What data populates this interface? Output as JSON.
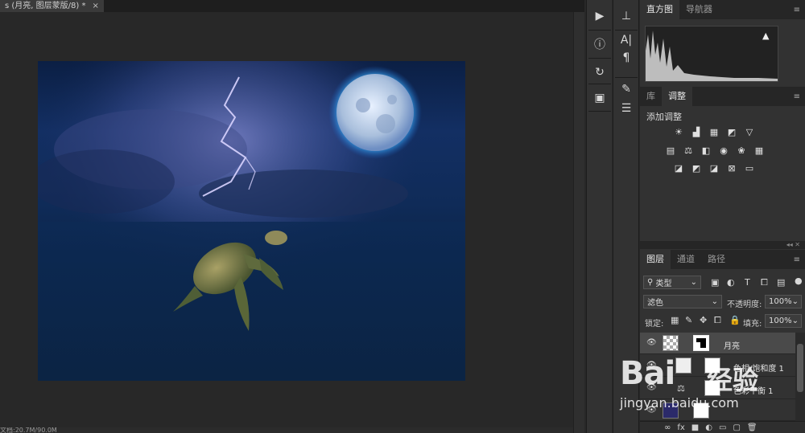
{
  "document": {
    "tab_title": "s (月亮, 图层蒙版/8) *",
    "tab_close": "×",
    "status_text": "文档:20.7M/90.0M"
  },
  "toolbar_col1": {
    "icons": [
      "play-icon",
      "info-icon",
      "history-icon",
      "3d-icon"
    ]
  },
  "toolbar_col2": {
    "icons": [
      "stamp-icon",
      "character-icon",
      "paragraph-icon",
      "brush-icon",
      "brush-settings-icon"
    ]
  },
  "panels": {
    "histogram_tabs": [
      "直方图",
      "导航器"
    ],
    "histogram_warning": "▲",
    "adjust_tabs": [
      "库",
      "调整"
    ],
    "adjust_title": "添加调整",
    "layers_tabs": [
      "图层",
      "通道",
      "路径"
    ],
    "filter_label": "类型",
    "blend_mode": "滤色",
    "opacity_label": "不透明度:",
    "opacity_value": "100%",
    "lock_label": "锁定:",
    "fill_label": "填充:",
    "fill_value": "100%",
    "collapse": "◂◂ ✕",
    "menu": "≡"
  },
  "layers": [
    {
      "name": "月亮",
      "selected": true
    },
    {
      "name": "色相/饱和度 1",
      "selected": false
    },
    {
      "name": "色彩平衡 1",
      "selected": false
    },
    {
      "name": "",
      "selected": false
    }
  ],
  "footer_icons": [
    "∞",
    "fx",
    "■",
    "◐",
    "▭",
    "▢",
    "🗑"
  ],
  "watermark": {
    "logo": "Bai",
    "cn": "经验",
    "url": "jingyan.baidu.com"
  },
  "colors": {
    "panel": "#323232",
    "tabbar": "#262626",
    "selected_layer": "#4a4a4a",
    "moon_glow": "#3fb8ff"
  }
}
